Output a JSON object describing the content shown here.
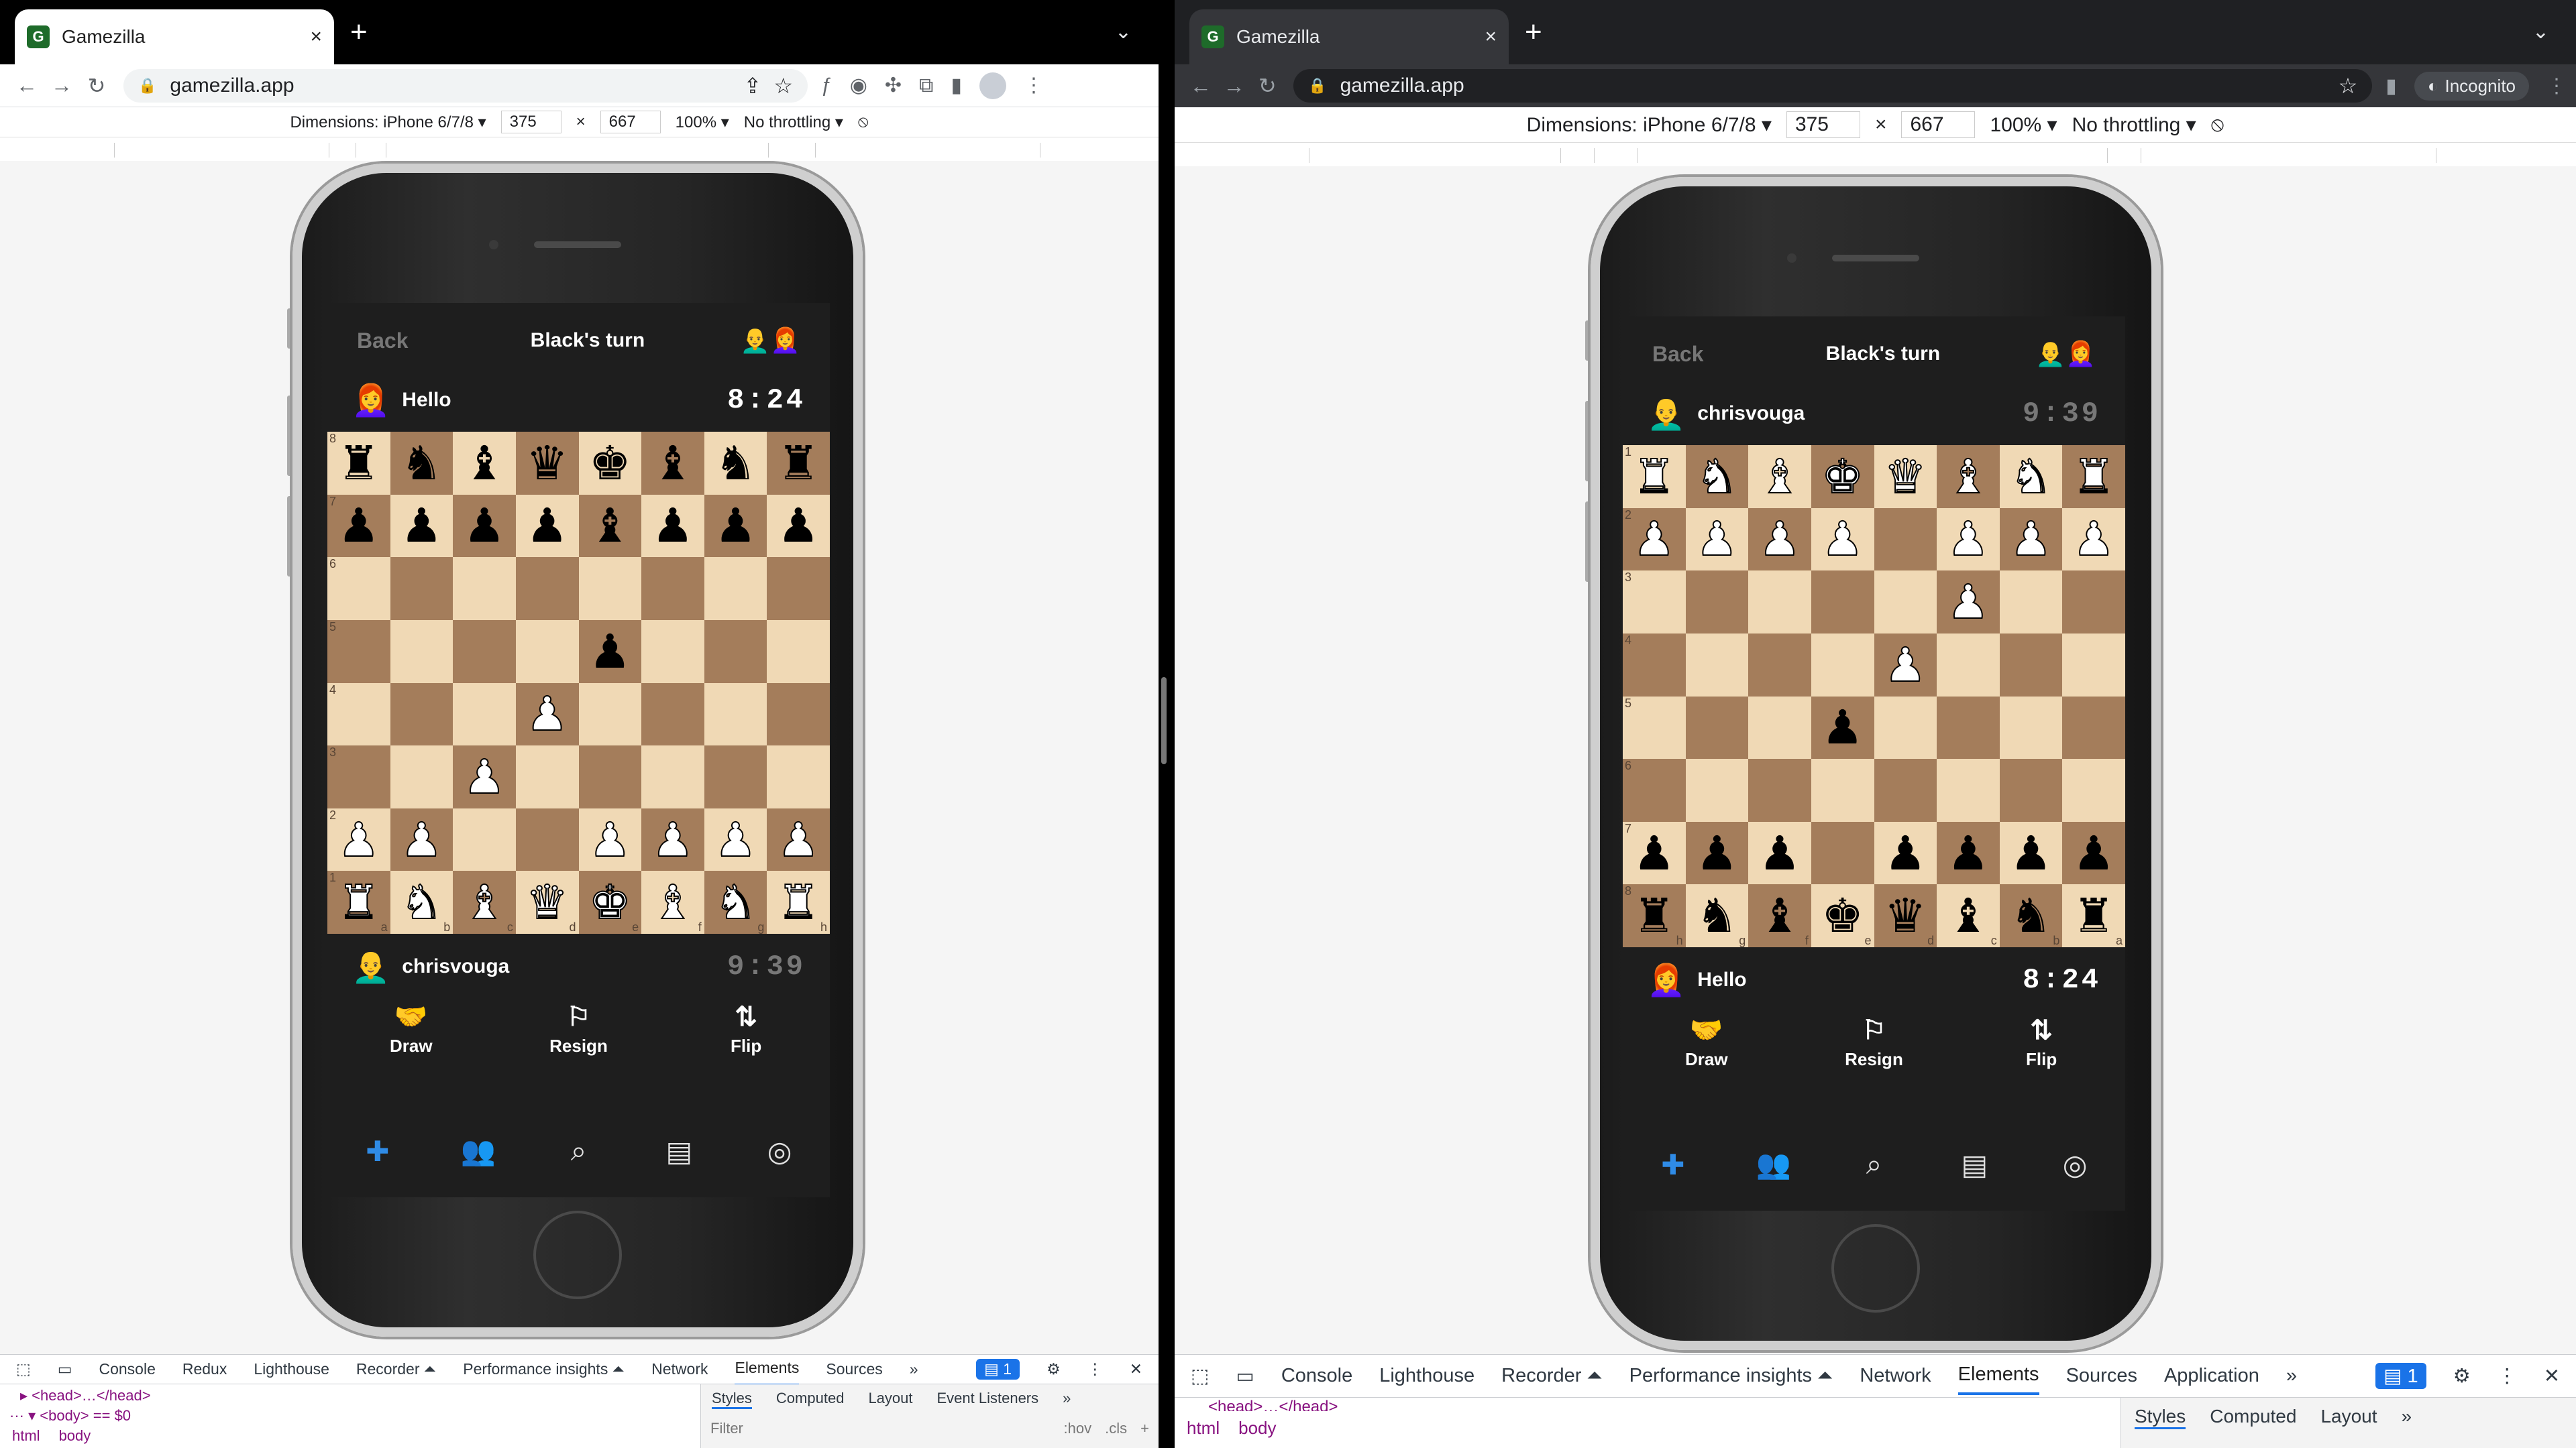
{
  "windows": [
    {
      "tab_title": "Gamezilla",
      "url": "gamezilla.app",
      "device": {
        "dims_label": "Dimensions: iPhone 6/7/8 ▾",
        "width": "375",
        "x": "×",
        "height": "667",
        "zoom": "100% ▾",
        "throttle": "No throttling ▾"
      },
      "game": {
        "back": "Back",
        "turn": "Black's turn",
        "header_emoji": "👨‍🦲👩‍🦰",
        "top_player": {
          "emoji": "👩‍🦰",
          "name": "Hello",
          "time": "8:24"
        },
        "bottom_player": {
          "emoji": "👨‍🦲",
          "name": "chrisvouga",
          "time": "9:39"
        },
        "draw": "Draw",
        "resign": "Resign",
        "flip": "Flip"
      },
      "devtools": {
        "tabs": [
          "Console",
          "Redux",
          "Lighthouse",
          "Recorder ⏶",
          "Performance insights ⏶",
          "Network",
          "Elements",
          "Sources",
          "»"
        ],
        "active": "Elements",
        "badge": "1",
        "head": "▸ <head>…</head>",
        "bodyline": "··· ▾ <body> == $0",
        "crumbs": [
          "html",
          "body"
        ],
        "side_tabs": [
          "Styles",
          "Computed",
          "Layout",
          "Event Listeners",
          "»"
        ],
        "filter": "Filter",
        "hov": ":hov",
        "cls": ".cls"
      }
    },
    {
      "tab_title": "Gamezilla",
      "url": "gamezilla.app",
      "incognito": "Incognito",
      "device": {
        "dims_label": "Dimensions: iPhone 6/7/8 ▾",
        "width": "375",
        "x": "×",
        "height": "667",
        "zoom": "100% ▾",
        "throttle": "No throttling ▾"
      },
      "game": {
        "back": "Back",
        "turn": "Black's turn",
        "header_emoji": "👨‍🦲👩‍🦰",
        "top_player": {
          "emoji": "👨‍🦲",
          "name": "chrisvouga",
          "time": "9:39"
        },
        "bottom_player": {
          "emoji": "👩‍🦰",
          "name": "Hello",
          "time": "8:24"
        },
        "draw": "Draw",
        "resign": "Resign",
        "flip": "Flip"
      },
      "devtools": {
        "tabs": [
          "Console",
          "Lighthouse",
          "Recorder ⏶",
          "Performance insights ⏶",
          "Network",
          "Elements",
          "Sources",
          "Application",
          "»"
        ],
        "active": "Elements",
        "badge": "1",
        "head": "<head>…</head>",
        "crumbs": [
          "html",
          "body"
        ],
        "side_tabs": [
          "Styles",
          "Computed",
          "Layout",
          "»"
        ]
      }
    }
  ],
  "boards": {
    "white_view": [
      "rnbqkbnr",
      "ppppbppp",
      "........",
      "....p...",
      "...P....",
      "..P.....",
      "PP..PPPP",
      "RNBQKBNR"
    ],
    "black_view": [
      "RNBKQBNR",
      "PPPP.PPP",
      ".....P..",
      "....P...",
      "...p....",
      "........",
      "ppp.pppp",
      "rnbkqbnr"
    ],
    "white_view_files": [
      "a",
      "b",
      "c",
      "d",
      "e",
      "f",
      "g",
      "h"
    ],
    "black_view_files": [
      "h",
      "g",
      "f",
      "e",
      "d",
      "c",
      "b",
      "a"
    ],
    "white_view_ranks": [
      "8",
      "7",
      "6",
      "5",
      "4",
      "3",
      "2",
      "1"
    ],
    "black_view_ranks": [
      "1",
      "2",
      "3",
      "4",
      "5",
      "6",
      "7",
      "8"
    ]
  },
  "piece_glyphs": {
    "k": "♚",
    "q": "♛",
    "r": "♜",
    "b": "♝",
    "n": "♞",
    "p": "♟"
  },
  "icons": {
    "draw": "handshake-icon",
    "resign": "flag-icon",
    "flip": "flip-icon",
    "nav": [
      "gamepad-icon",
      "friends-icon",
      "search-icon",
      "chat-icon",
      "profile-icon"
    ]
  },
  "colors": {
    "light_square": "#f0d9b5",
    "dark_square": "#a47d5b",
    "nav_active": "#2f8be6",
    "app_bg": "#1e1e1e"
  }
}
